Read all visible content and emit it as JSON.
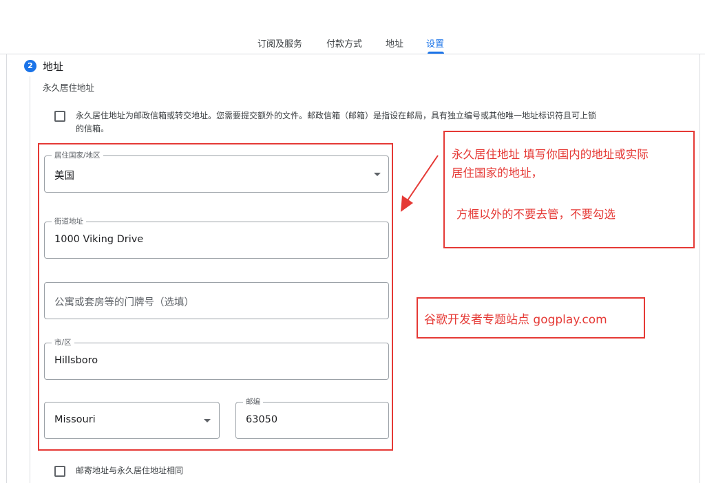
{
  "tabs": [
    {
      "label": "订阅及服务",
      "active": false
    },
    {
      "label": "付款方式",
      "active": false
    },
    {
      "label": "地址",
      "active": false
    },
    {
      "label": "设置",
      "active": true
    }
  ],
  "section": {
    "step_number": "2",
    "title": "地址",
    "subtitle": "永久居住地址"
  },
  "po_box_checkbox": {
    "checked": false,
    "line1": "永久居住地址为邮政信箱或转交地址。您需要提交额外的文件。邮政信箱（邮箱）是指设在邮局，具有独立编号或其他唯一地址标识符且可上锁",
    "line2": "的信箱。"
  },
  "form": {
    "country": {
      "label": "居住国家/地区",
      "value": "美国"
    },
    "street": {
      "label": "街道地址",
      "value": "1000 Viking Drive"
    },
    "apartment": {
      "placeholder": "公寓或套房等的门牌号（选填）"
    },
    "city": {
      "label": "市/区",
      "value": "Hillsboro"
    },
    "state": {
      "value": "Missouri"
    },
    "postal": {
      "label": "邮编",
      "value": "63050"
    }
  },
  "mailing_checkbox": {
    "checked": false,
    "label": "邮寄地址与永久居住地址相同"
  },
  "annotations": {
    "note_line1": "永久居住地址 填写你国内的地址或实际",
    "note_line2": "居住国家的地址，",
    "note_line3": "方框以外的不要去管，不要勾选",
    "site_banner": "谷歌开发者专题站点 gogplay.com",
    "color": "#e53935"
  },
  "colors": {
    "accent": "#1a73e8",
    "border": "#9aa0a6",
    "divider": "#dadce0"
  }
}
